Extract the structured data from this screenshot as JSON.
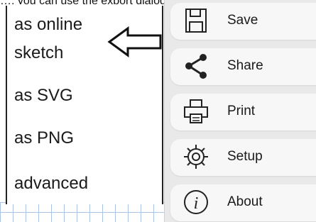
{
  "top_strip_text": "…, you can use the export dialog …",
  "export_menu": {
    "items": [
      "as online",
      "sketch",
      "as SVG",
      "as PNG",
      "advanced"
    ]
  },
  "side_menu": {
    "items": [
      {
        "label": "Save",
        "icon": "save-icon"
      },
      {
        "label": "Share",
        "icon": "share-icon"
      },
      {
        "label": "Print",
        "icon": "print-icon"
      },
      {
        "label": "Setup",
        "icon": "setup-icon"
      },
      {
        "label": "About",
        "icon": "about-icon"
      }
    ]
  },
  "colors": {
    "panel_bg": "#e9e9e9",
    "button_bg": "#f7f7f7",
    "grid_line": "#a9c4e4"
  }
}
